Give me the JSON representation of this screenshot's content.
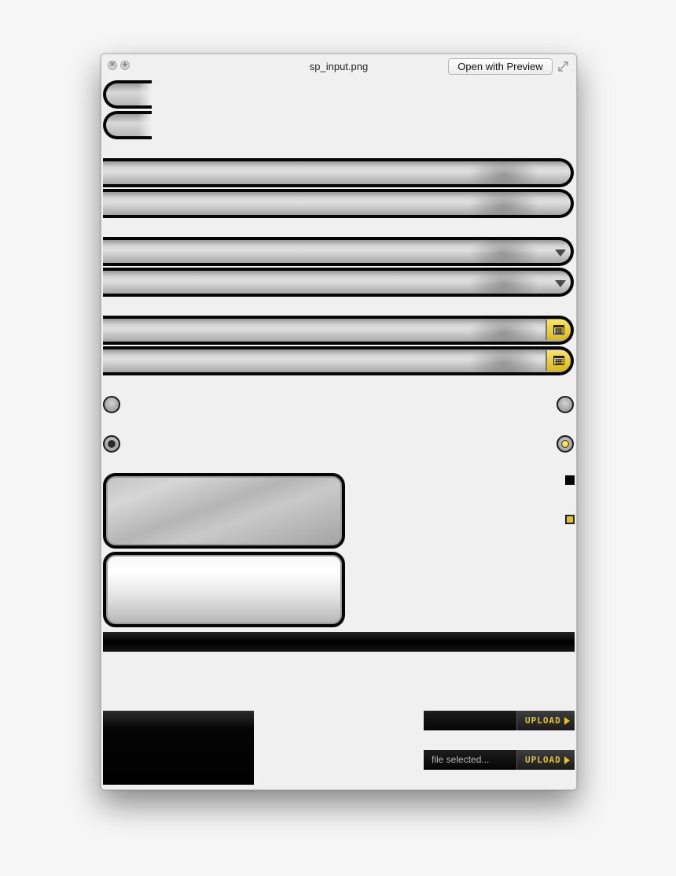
{
  "window": {
    "title": "sp_input.png",
    "open_button_label": "Open with Preview",
    "close_glyph": "✕",
    "zoom_glyph": "+"
  },
  "radios": {
    "left_top_state": "unchecked",
    "right_top_state": "unchecked",
    "left_bottom_state": "checked-dark",
    "right_bottom_state": "checked-yellow"
  },
  "checkboxes": {
    "top_state": "filled-black",
    "bottom_state": "filled-yellow"
  },
  "upload": {
    "row1_text": "",
    "row2_text": "file selected...",
    "button_label": "UPLOAD"
  },
  "icons": {
    "select_arrow": "chevron-down-icon",
    "calendar": "calendar-icon",
    "expand": "expand-icon",
    "upload_arrow": "play-triangle-icon"
  },
  "colors": {
    "accent_yellow": "#e0c22a",
    "field_border": "#060606",
    "background": "#f0f0f0"
  }
}
